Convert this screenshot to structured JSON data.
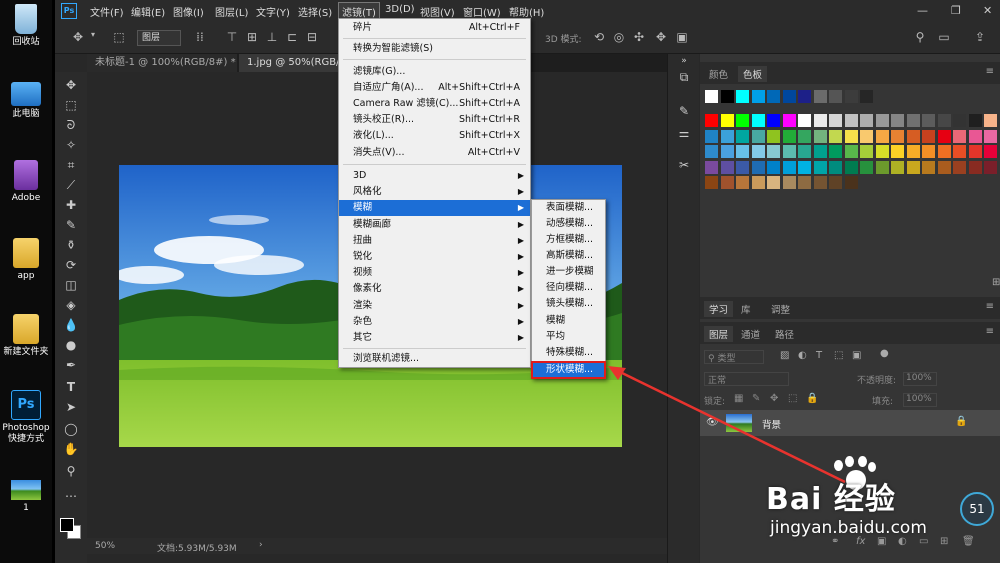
{
  "desktop": {
    "icons": [
      {
        "label": "回收站"
      },
      {
        "label": "此电脑"
      },
      {
        "label": "Adobe"
      },
      {
        "label": "app"
      },
      {
        "label": "新建文件夹"
      },
      {
        "label": "Photoshop\n快捷方式"
      },
      {
        "label": "1"
      }
    ]
  },
  "menubar": {
    "logo": "Ps",
    "items": [
      "文件(F)",
      "编辑(E)",
      "图像(I)",
      "图层(L)",
      "文字(Y)",
      "选择(S)",
      "滤镜(T)",
      "3D(D)",
      "视图(V)",
      "窗口(W)",
      "帮助(H)"
    ],
    "active": "滤镜(T)"
  },
  "options": {
    "layer_select": "图层",
    "mode_3d": "3D 模式:"
  },
  "tabs": [
    {
      "label": "未标题-1 @ 100%(RGB/8#) *"
    },
    {
      "label": "1.jpg @ 50%(RGB/8*)"
    }
  ],
  "status": {
    "zoom": "50%",
    "doc": "文档:5.93M/5.93M"
  },
  "filter_menu": [
    {
      "label": "碎片",
      "shortcut": "Alt+Ctrl+F"
    },
    {
      "label": "转换为智能滤镜(S)",
      "shortcut": ""
    },
    {
      "label": "滤镜库(G)...",
      "shortcut": ""
    },
    {
      "label": "自适应广角(A)...",
      "shortcut": "Alt+Shift+Ctrl+A"
    },
    {
      "label": "Camera Raw 滤镜(C)...",
      "shortcut": "Shift+Ctrl+A"
    },
    {
      "label": "镜头校正(R)...",
      "shortcut": "Shift+Ctrl+R"
    },
    {
      "label": "液化(L)...",
      "shortcut": "Shift+Ctrl+X"
    },
    {
      "label": "消失点(V)...",
      "shortcut": "Alt+Ctrl+V"
    },
    {
      "label": "3D",
      "submenu": true
    },
    {
      "label": "风格化",
      "submenu": true
    },
    {
      "label": "模糊",
      "submenu": true,
      "highlighted": true
    },
    {
      "label": "模糊画廊",
      "submenu": true
    },
    {
      "label": "扭曲",
      "submenu": true
    },
    {
      "label": "锐化",
      "submenu": true
    },
    {
      "label": "视频",
      "submenu": true
    },
    {
      "label": "像素化",
      "submenu": true
    },
    {
      "label": "渲染",
      "submenu": true
    },
    {
      "label": "杂色",
      "submenu": true
    },
    {
      "label": "其它",
      "submenu": true
    },
    {
      "label": "浏览联机滤镜...",
      "shortcut": ""
    }
  ],
  "blur_submenu": [
    {
      "label": "表面模糊..."
    },
    {
      "label": "动感模糊..."
    },
    {
      "label": "方框模糊..."
    },
    {
      "label": "高斯模糊..."
    },
    {
      "label": "进一步模糊"
    },
    {
      "label": "径向模糊..."
    },
    {
      "label": "镜头模糊..."
    },
    {
      "label": "模糊"
    },
    {
      "label": "平均"
    },
    {
      "label": "特殊模糊..."
    },
    {
      "label": "形状模糊...",
      "highlighted": true
    }
  ],
  "color_panel": {
    "tabs": [
      "颜色",
      "色板"
    ],
    "active": "色板"
  },
  "learn_tabs": [
    "学习",
    "库",
    "调整"
  ],
  "layers_panel": {
    "tabs": [
      "图层",
      "通道",
      "路径"
    ],
    "active": "图层",
    "filter_label": "类型",
    "blend_mode": "正常",
    "opacity_label": "不透明度:",
    "opacity": "100%",
    "lock_label": "锁定:",
    "fill_label": "填充:",
    "fill": "100%",
    "layers": [
      {
        "name": "背景",
        "locked": true
      }
    ]
  },
  "watermark": {
    "brand": "Bai 经验",
    "url": "jingyan.baidu.com",
    "badge": "51"
  },
  "colors": {
    "accent": "#1c6ed6",
    "highlight_outline": "#e01b1b"
  }
}
